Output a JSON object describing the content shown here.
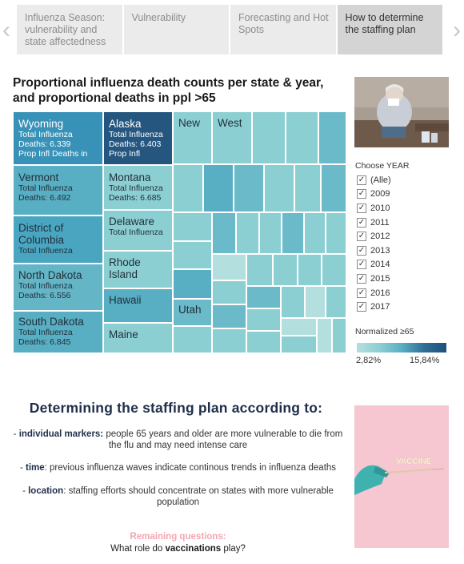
{
  "story": {
    "tabs": [
      {
        "label": "Influenza Season: vulnerability and state affectedness",
        "active": false
      },
      {
        "label": "Vulnerability",
        "active": false
      },
      {
        "label": "Forecasting and Hot Spots",
        "active": false
      },
      {
        "label": "How to determine the staffing plan",
        "active": true
      }
    ],
    "prev_icon": "chevron-left",
    "next_icon": "chevron-right"
  },
  "treemap": {
    "title": "Proportional influenza death counts per state & year, and proportional deaths in ppl >65",
    "labeled_cells": [
      {
        "name": "Wyoming",
        "line1": "Total Influenza",
        "line2": "Deaths: 6.339",
        "line3": "Prop Infl Deaths in"
      },
      {
        "name": "Alaska",
        "line1": "Total Influenza",
        "line2": "Deaths: 6.403",
        "line3": "Prop Infl"
      },
      {
        "name": "New"
      },
      {
        "name": "West"
      },
      {
        "name": "Vermont",
        "line1": "Total Influenza",
        "line2": "Deaths: 6.492"
      },
      {
        "name": "Montana",
        "line1": "Total Influenza",
        "line2": "Deaths: 6.685"
      },
      {
        "name": "District of Columbia",
        "line1": "Total Influenza"
      },
      {
        "name": "Delaware",
        "line1": "Total Influenza"
      },
      {
        "name": "North Dakota",
        "line1": "Total Influenza",
        "line2": "Deaths: 6.556"
      },
      {
        "name": "Rhode Island"
      },
      {
        "name": "Hawaii"
      },
      {
        "name": "Utah"
      },
      {
        "name": "South Dakota",
        "line1": "Total Influenza",
        "line2": "Deaths: 6.845"
      },
      {
        "name": "Maine"
      }
    ]
  },
  "filter": {
    "title": "Choose YEAR",
    "options": [
      {
        "label": "(Alle)",
        "checked": true
      },
      {
        "label": "2009",
        "checked": true
      },
      {
        "label": "2010",
        "checked": true
      },
      {
        "label": "2011",
        "checked": true
      },
      {
        "label": "2012",
        "checked": true
      },
      {
        "label": "2013",
        "checked": true
      },
      {
        "label": "2014",
        "checked": true
      },
      {
        "label": "2015",
        "checked": true
      },
      {
        "label": "2016",
        "checked": true
      },
      {
        "label": "2017",
        "checked": true
      }
    ],
    "check_glyph": "✓"
  },
  "legend": {
    "title": "Normalized ≥65",
    "min": "2,82%",
    "max": "15,84%",
    "colors": [
      "#b3e0df",
      "#8ccfd3",
      "#5aaec2",
      "#2f6f97",
      "#1e4f7b"
    ]
  },
  "plan": {
    "heading": "Determining the staffing plan according to:",
    "bullets": [
      {
        "prefix": "- ",
        "key": "individual markers:",
        "text": " people 65 years and older are more vulnerable to die from the flu and may need intense care"
      },
      {
        "prefix": "- ",
        "key": "time",
        "text": ": previous influenza waves indicate continous trends in influenza deaths"
      },
      {
        "prefix": "- ",
        "key": "location",
        "text": ": staffing efforts should concentrate on states with more vulnerable population"
      }
    ],
    "remaining_label": "Remaining questions:",
    "remaining_pre": "What role do ",
    "remaining_key": "vaccinations",
    "remaining_post": " play?",
    "vaccine_word": "VACCINE"
  }
}
